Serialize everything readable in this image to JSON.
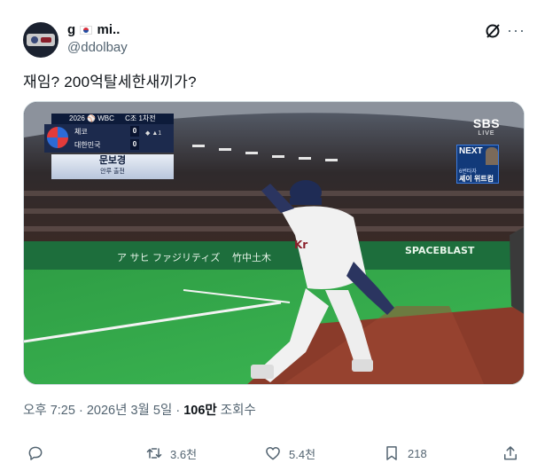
{
  "header": {
    "display_name_prefix": "g",
    "display_name_suffix": "mi..",
    "handle": "@ddolbay"
  },
  "tweet": {
    "text": "재임? 200억탈세한새끼가?"
  },
  "media": {
    "scoreboard": {
      "tournament": "2026 ⚾ WBC",
      "group": "C조 1차전",
      "teams": [
        {
          "name": "체코",
          "score": "0"
        },
        {
          "name": "대한민국",
          "score": "0"
        }
      ],
      "inning": "1",
      "player_name": "문보경",
      "player_role": "안루 출전"
    },
    "broadcaster": "SBS",
    "broadcaster_sub": "LIVE",
    "next_label": "NEXT",
    "next_sub": "6번타자",
    "next_player": "셰이 위트컴",
    "ad_banners": [
      "ア サヒ ファジリティズ",
      "竹中土木",
      "SPACEBLAST"
    ]
  },
  "meta": {
    "time": "오후 7:25",
    "date": "2026년 3월 5일",
    "views": "106만",
    "views_label": "조회수"
  },
  "actions": {
    "reply_count": "",
    "retweet_count": "3.6천",
    "like_count": "5.4천",
    "bookmark_count": "218"
  },
  "colors": {
    "text": "#0f1419",
    "secondary": "#536471",
    "border": "#cfd9de"
  }
}
